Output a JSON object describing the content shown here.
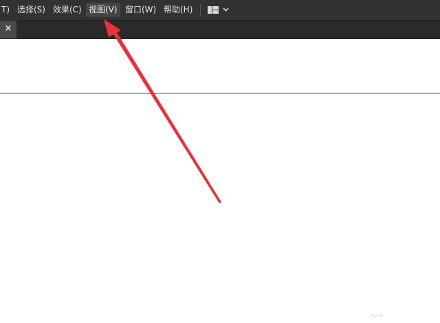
{
  "menubar": {
    "items": [
      {
        "label": "T)",
        "active": false
      },
      {
        "label": "选择(S)",
        "active": false
      },
      {
        "label": "效果(C)",
        "active": false
      },
      {
        "label": "视图(V)",
        "active": true
      },
      {
        "label": "窗口(W)",
        "active": false
      },
      {
        "label": "帮助(H)",
        "active": false
      }
    ],
    "workspace_icon": "workspace-layout-icon",
    "workspace_chevron": "chevron-down-icon"
  },
  "tabbar": {
    "close_glyph": "×"
  },
  "annotation": {
    "color": "#e8323a",
    "icon": "red-arrow-pointing-to-view-menu"
  },
  "colors": {
    "menubar_bg": "#323232",
    "tabbar_bg": "#2a2a2a",
    "canvas_bg": "#ffffff"
  }
}
